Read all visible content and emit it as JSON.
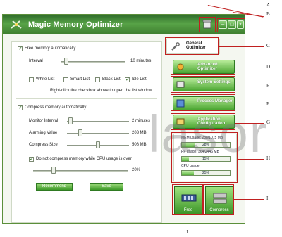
{
  "window": {
    "title": "Magic Memory Optimizer"
  },
  "nav": {
    "general": "General Optimizer",
    "advanced": "Advanced Optimizer",
    "system": "System Settings",
    "process": "Process Manager",
    "application": "Application Configuration"
  },
  "general": {
    "free_auto_label": "Free memory automatically",
    "free_auto_checked": true,
    "interval_label": "Interval",
    "interval_value": "10 minutes",
    "interval_level": 0.05,
    "lists": [
      {
        "label": "White List",
        "checked": false
      },
      {
        "label": "Smart List",
        "checked": false
      },
      {
        "label": "Black List",
        "checked": false
      },
      {
        "label": "Idle List",
        "checked": true
      }
    ],
    "list_hint": "Right-click the checkbox above to open the list window.",
    "compress_auto_label": "Compress memory automatically",
    "compress_auto_checked": true,
    "monitor_label": "Monitor Interval",
    "monitor_value": "2 minutes",
    "monitor_level": 0.02,
    "alarming_label": "Alarming Value",
    "alarming_value": "203 MB",
    "alarming_level": 0.2,
    "compress_label": "Compress Size",
    "compress_value": "508 MB",
    "compress_level": 0.5,
    "cpu_label": "Do not compress memory while CPU usage is over",
    "cpu_checked": true,
    "cpu_value": "20%",
    "cpu_level": 0.2,
    "recommend_button": "Recommend",
    "save_button": "Save"
  },
  "stats": {
    "mem_label": "MEM usage: 288/1015 MB",
    "mem_percent": "28%",
    "mem_level": 0.28,
    "pf_label": "PF usage: 364/2446 MB",
    "pf_percent": "15%",
    "pf_level": 0.15,
    "cpu_label": "CPU usage",
    "cpu_percent": "25%",
    "cpu_level": 0.25
  },
  "actions": {
    "free": "Free",
    "compress": "Compress"
  },
  "watermark": "lasor",
  "markers": {
    "A": "A",
    "B": "B",
    "C": "C",
    "D": "D",
    "E": "E",
    "F": "F",
    "G": "G",
    "H": "H",
    "I": "I",
    "J": "J"
  }
}
